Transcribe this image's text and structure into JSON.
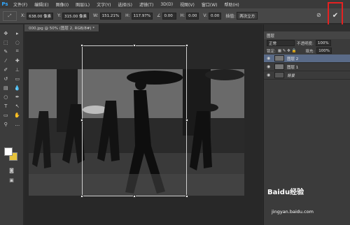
{
  "app": {
    "logo": "Ps"
  },
  "menu": [
    "文件(F)",
    "编辑(E)",
    "图像(I)",
    "图层(L)",
    "文字(Y)",
    "选择(S)",
    "滤镜(T)",
    "3D(D)",
    "视图(V)",
    "窗口(W)",
    "帮助(H)"
  ],
  "options": {
    "x": {
      "label": "X:",
      "value": "638.00 像素"
    },
    "y": {
      "label": "Y:",
      "value": "315.00 像素"
    },
    "w": {
      "label": "W:",
      "value": "151.21%"
    },
    "h": {
      "label": "H:",
      "value": "117.97%"
    },
    "angle": {
      "label": "∠",
      "value": "0.00"
    },
    "hskew": {
      "label": "H:",
      "value": "0.00"
    },
    "vskew": {
      "label": "V:",
      "value": "0.00"
    },
    "interp_label": "插值:",
    "interp_value": "两次立方",
    "commit_icon": "✔",
    "cancel_icon": "⊘"
  },
  "document": {
    "tab_title": "000.jpg @ 50% (图层 2, RGB/8#) *"
  },
  "layers_panel": {
    "title": "图层",
    "blend_mode": "正常",
    "opacity_label": "不透明度:",
    "opacity_value": "100%",
    "fill_label": "填充:",
    "fill_value": "100%",
    "lock_label": "锁定:",
    "layers": [
      {
        "name": "图层 2",
        "active": true
      },
      {
        "name": "图层 1",
        "active": false
      },
      {
        "name": "背景",
        "active": false
      }
    ]
  },
  "colors": {
    "foreground": "#ffffff",
    "background": "#e5c23b",
    "highlight": "#e52121"
  },
  "watermark": {
    "brand": "Baidu经验",
    "url": "jingyan.baidu.com"
  }
}
